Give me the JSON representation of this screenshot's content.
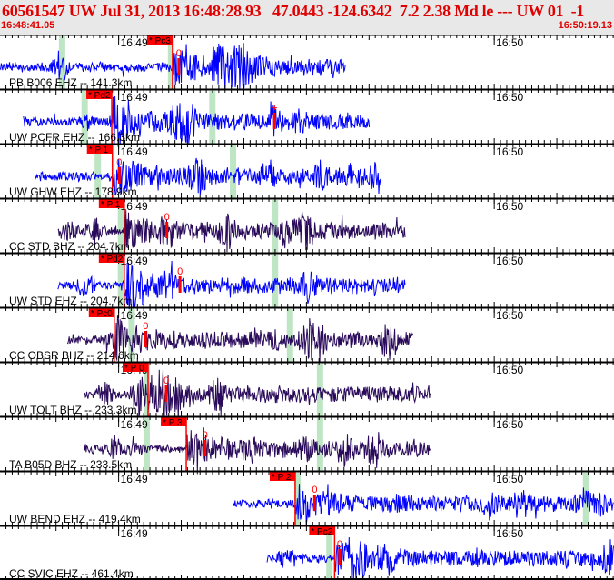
{
  "header": {
    "title": "60561547 UW Jul 31, 2013 16:48:28.93   47.0443 -124.6342  7.2 2.38 Md le --- UW 01  -1",
    "start_time": "16:48:41.05",
    "end_time": "16:50:19.13"
  },
  "time_axis": {
    "start_s": 41.05,
    "end_s": 139.13,
    "minute_labels": [
      {
        "t": 60,
        "label": "16:49"
      },
      {
        "t": 120,
        "label": "16:50"
      }
    ]
  },
  "colors": {
    "header_bg": "#e8e8e8",
    "header_text": "#e00000",
    "pick": "#ff0000",
    "window": "#bfe6c4",
    "ehz_trace": "#0000ff",
    "bhz_trace": "#2a0a5a"
  },
  "panels": [
    {
      "label": "PB B006 EHZ -- 141.3km",
      "color": "#0000ff",
      "trace": [
        41.05,
        96.2
      ],
      "pick_label": "* Pc3",
      "pick_t": 68.6,
      "marker": "0",
      "marker_t": 69.6,
      "windows": [
        50.9,
        68.3
      ]
    },
    {
      "label": "UW PCFR EHZ -- 166.3km",
      "color": "#0000ff",
      "trace": [
        44.8,
        100.1
      ],
      "pick_label": "* Pd2",
      "pick_t": 58.9,
      "marker": "+",
      "marker_t": 84.9,
      "windows": [
        54.5,
        74.9
      ]
    },
    {
      "label": "UW GHW EHZ -- 178.9km",
      "color": "#0000ff",
      "trace": [
        46.6,
        102.0
      ],
      "pick_label": "* P 1",
      "pick_t": 59.0,
      "marker": "0",
      "marker_t": 60.1,
      "windows": [
        56.6,
        78.2
      ]
    },
    {
      "label": "CC STD BHZ -- 204.7km",
      "color": "#2a0a5a",
      "trace": [
        50.3,
        105.8
      ],
      "pick_label": "* P 1",
      "pick_t": 60.9,
      "marker": "0",
      "marker_t": 67.7,
      "windows": [
        60.3,
        84.9
      ]
    },
    {
      "label": "UW STD EHZ -- 204.7km",
      "color": "#0000ff",
      "trace": [
        50.3,
        105.8
      ],
      "pick_label": "* Pd2",
      "pick_t": 60.9,
      "marker": "0",
      "marker_t": 69.8,
      "windows": [
        60.3,
        84.9
      ]
    },
    {
      "label": "CC OBSR BHZ -- 214.6km",
      "color": "#2a0a5a",
      "trace": [
        51.8,
        107.1
      ],
      "pick_label": "* Pc0",
      "pick_t": 59.3,
      "marker": "0",
      "marker_t": 64.3,
      "windows": [
        62.0,
        87.3
      ]
    },
    {
      "label": "UW TOLT BHZ -- 233.3km",
      "color": "#2a0a5a",
      "trace": [
        54.5,
        109.8
      ],
      "pick_label": "* P 0",
      "pick_t": 64.7,
      "marker": "0",
      "marker_t": 67.6,
      "windows": [
        64.4,
        92.1
      ]
    },
    {
      "label": "TA B05D BHZ -- 233.5km",
      "color": "#2a0a5a",
      "trace": [
        54.5,
        109.8
      ],
      "pick_label": "* P 3",
      "pick_t": 70.8,
      "marker": "0",
      "marker_t": 73.8,
      "windows": [
        64.4,
        92.1
      ]
    },
    {
      "label": "UW BEND EHZ -- 419.4km",
      "color": "#0000ff",
      "trace": [
        78.3,
        139.13
      ],
      "pick_label": "* P 2",
      "pick_t": 88.2,
      "marker": "0",
      "marker_t": 91.3,
      "windows": [
        88.5,
        134.6
      ]
    },
    {
      "label": "CC SVIC EHZ -- 461.4km",
      "color": "#0000ff",
      "trace": [
        83.7,
        139.13
      ],
      "pick_label": "* Pc2",
      "pick_t": 94.5,
      "marker": "0",
      "marker_t": 95.3,
      "windows": [
        93.6
      ]
    }
  ]
}
